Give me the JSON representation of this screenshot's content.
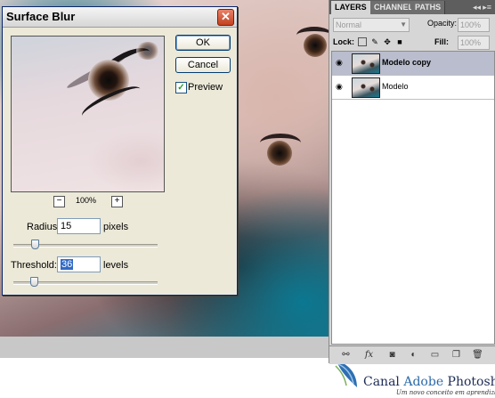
{
  "dialog": {
    "title": "Surface Blur",
    "close_glyph": "✕",
    "ok_label": "OK",
    "cancel_label": "Cancel",
    "preview_label": "Preview",
    "preview_checked_glyph": "✓",
    "zoom_out_glyph": "−",
    "zoom_in_glyph": "+",
    "zoom_level": "100%",
    "radius": {
      "label": "Radius:",
      "value": "15",
      "unit": "pixels",
      "slider_fraction": 0.15
    },
    "threshold": {
      "label": "Threshold:",
      "value": "36",
      "unit": "levels",
      "slider_fraction": 0.14
    }
  },
  "layers_panel": {
    "tabs": [
      "LAYERS",
      "CHANNEL",
      "PATHS"
    ],
    "menu_glyph": "▸≡",
    "close_glyph": "◂◂",
    "blend_mode": "Normal",
    "opacity_label": "Opacity:",
    "opacity_value": "100%",
    "lock_label": "Lock:",
    "lock_icons": [
      "transparency-lock-icon",
      "brush-lock-icon",
      "move-lock-icon",
      "padlock-icon"
    ],
    "fill_label": "Fill:",
    "fill_value": "100%",
    "layers": [
      {
        "name": "Modelo copy",
        "selected": true,
        "visible": true
      },
      {
        "name": "Modelo",
        "selected": false,
        "visible": true
      }
    ],
    "bottom_icons": [
      "link-icon",
      "fx-icon",
      "mask-icon",
      "adjustment-icon",
      "group-icon",
      "new-layer-icon",
      "trash-icon"
    ]
  },
  "watermark": {
    "brand_prefix": "Canal ",
    "brand_accent": "Adobe",
    "brand_suffix": " Photoshop",
    "tagline": "Um novo conceito em aprendizado"
  },
  "colors": {
    "dialog_bg": "#ece9d8",
    "accent_teal": "#0b7891",
    "selected_layer": "#b9bdcd"
  }
}
